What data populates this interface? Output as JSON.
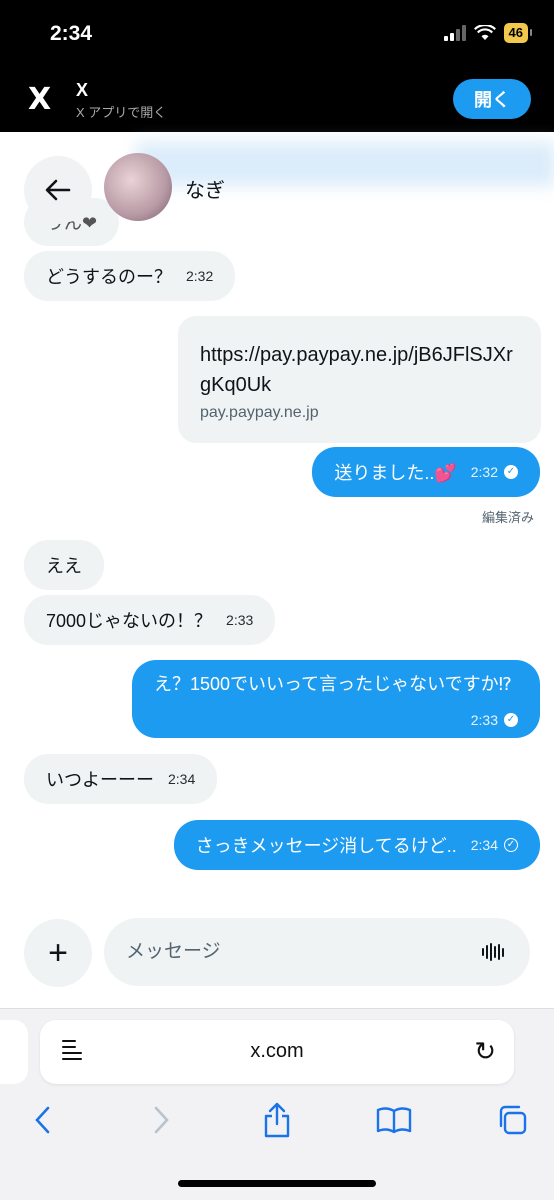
{
  "status_bar": {
    "time": "2:34",
    "battery": "46"
  },
  "app_banner": {
    "logo": "X",
    "title": "X",
    "subtitle": "X アプリで開く",
    "open_label": "開く"
  },
  "chat": {
    "peer_name": "なぎ",
    "messages": [
      {
        "dir": "in",
        "text": "うん❤",
        "time": ""
      },
      {
        "dir": "in",
        "text": "どうするのー？",
        "time": "2:32"
      },
      {
        "dir": "out",
        "type": "link",
        "url": "https://pay.paypay.ne.jp/jB6JFlSJXrgKq0Uk",
        "domain": "pay.paypay.ne.jp"
      },
      {
        "dir": "out",
        "text": "送りました..💕",
        "time": "2:32",
        "status": "read"
      },
      {
        "dir": "in",
        "text": "ええ",
        "time": ""
      },
      {
        "dir": "in",
        "text": "7000じゃないの！？",
        "time": "2:33"
      },
      {
        "dir": "out",
        "text": "え？1500でいいって言ったじゃないですか⁉",
        "time": "2:33",
        "status": "read"
      },
      {
        "dir": "in",
        "text": "いつよーーー",
        "time": "2:34"
      },
      {
        "dir": "out",
        "text": "さっきメッセージ消してるけど..",
        "time": "2:34",
        "status": "sent"
      }
    ],
    "edited_label": "編集済み"
  },
  "composer": {
    "placeholder": "メッセージ"
  },
  "browser": {
    "url": "x.com"
  },
  "colors": {
    "accent": "#1d9bf0",
    "bubble_in": "#eff3f4",
    "banner_bg": "#000000"
  },
  "icons": [
    "back-arrow-icon",
    "plus-icon",
    "voice-wave-icon",
    "reader-icon",
    "reload-icon",
    "share-icon",
    "bookmarks-icon",
    "tabs-icon"
  ]
}
